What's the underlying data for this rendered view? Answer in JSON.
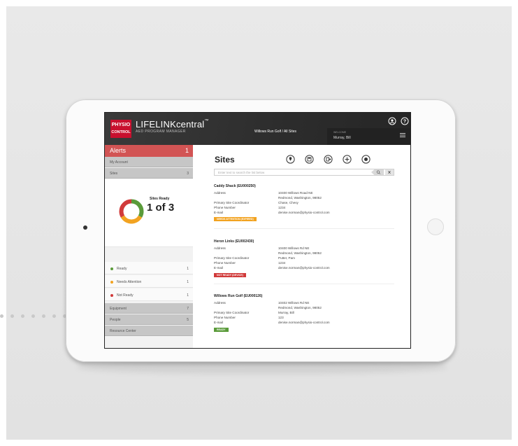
{
  "app": {
    "logo_line1": "PHYSIO",
    "logo_line2": "CONTROL",
    "brand": "LIFELINKcentral",
    "brand_tm": "™",
    "brand_sub": "AED PROGRAM MANAGER",
    "breadcrumb": "Willows Run Golf / All Sites",
    "welcome_label": "WELCOME",
    "welcome_name": "Murray, Bill"
  },
  "header_icons": [
    "account-icon",
    "help-icon"
  ],
  "sidebar": {
    "alerts": {
      "label": "Alerts",
      "count": "1"
    },
    "items": [
      {
        "label": "My Account",
        "count": ""
      },
      {
        "label": "Sites",
        "count": "3"
      }
    ],
    "summary": {
      "label": "Sites Ready",
      "value": "1 of 3"
    },
    "statuses": [
      {
        "label": "Ready",
        "count": "1",
        "color": "#5a9b3a"
      },
      {
        "label": "Needs Attention",
        "count": "1",
        "color": "#f2a321"
      },
      {
        "label": "Not Ready",
        "count": "1",
        "color": "#d13a3a"
      }
    ],
    "bottom_items": [
      {
        "label": "Equipment",
        "count": "7"
      },
      {
        "label": "People",
        "count": "5"
      },
      {
        "label": "Resource Center",
        "count": ""
      }
    ]
  },
  "donut": {
    "ready": 1,
    "needs_attention": 1,
    "not_ready": 1,
    "colors": [
      "#5a9b3a",
      "#f2a321",
      "#d13a3a"
    ]
  },
  "main": {
    "title": "Sites",
    "action_icons": [
      "location-pin-icon",
      "save-icon",
      "export-icon",
      "add-icon",
      "record-icon"
    ],
    "search_placeholder": "Enter text to search the list below"
  },
  "field_labels": {
    "address": "Address",
    "coordinator": "Primary Site Coordinator",
    "phone": "Phone Number",
    "email": "E-mail"
  },
  "sites": [
    {
      "name": "Caddy Shack (EU000250)",
      "address1": "10400 Willows Road NE",
      "address2": "Redmond, Washington, 98052",
      "coordinator": "Chase, Chevy",
      "phone": "1234",
      "email": "denise.norman@physio-control.com",
      "status": "NEEDS ATTENTION (EXPIRED)",
      "status_color": "#f2a321"
    },
    {
      "name": "Heron Links (EU002430)",
      "address1": "10400 Willows Rd NE",
      "address2": "Redmond, Washington, 98052",
      "coordinator": "Putter, Pam",
      "phone": "1234",
      "email": "denise.norman@physio-control.com",
      "status": "NOT READY (DEVICE)",
      "status_color": "#d13a3a"
    },
    {
      "name": "Willows Run Golf (EU000126)",
      "address1": "10402 Willows Rd NE",
      "address2": "Redmond, Washington, 98052",
      "coordinator": "Murray, Bill",
      "phone": "123",
      "email": "denise.norman@physio-control.com",
      "status": "READY",
      "status_color": "#5a9b3a"
    }
  ]
}
